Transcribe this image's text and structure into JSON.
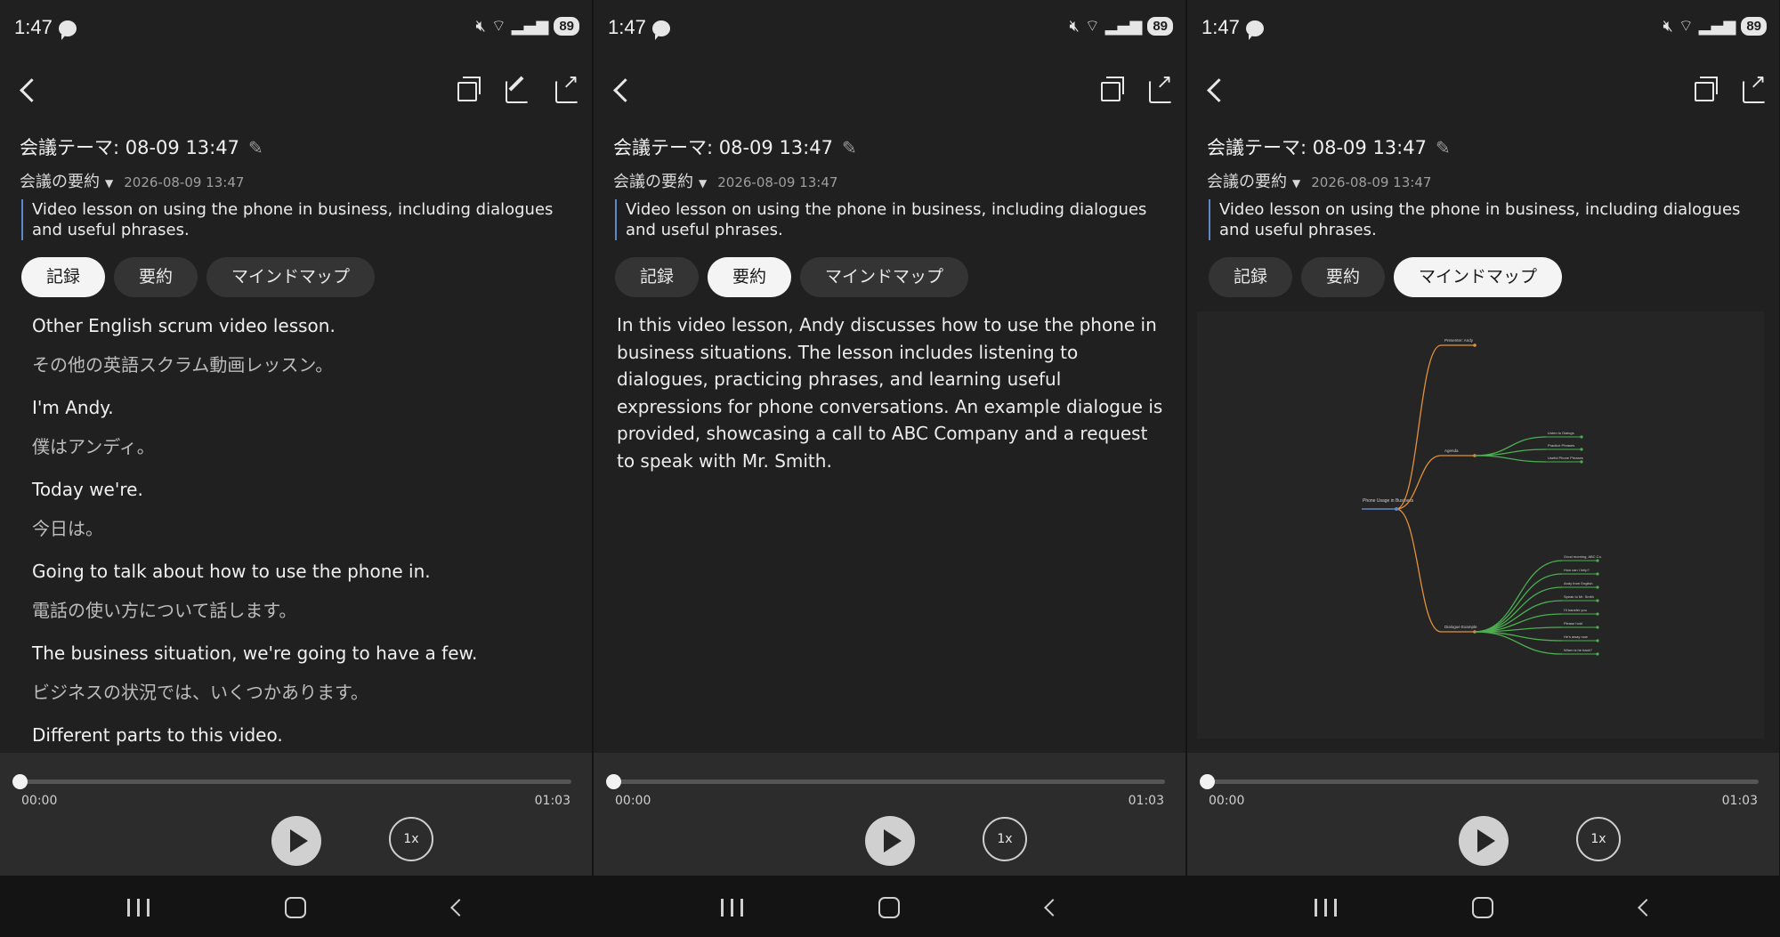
{
  "status_bar": {
    "time": "1:47",
    "battery": "89"
  },
  "meeting": {
    "title": "会議テーマ: 08-09 13:47",
    "summary_label": "会議の要約",
    "date": "2026-08-09 13:47",
    "short_summary": "Video lesson on using the phone in business, including dialogues and useful phrases."
  },
  "tabs": {
    "record": "記録",
    "summary": "要約",
    "mindmap": "マインドマップ"
  },
  "transcript": [
    {
      "en": "Other English scrum video lesson.",
      "ja": "その他の英語スクラム動画レッスン。"
    },
    {
      "en": "I'm Andy.",
      "ja": "僕はアンディ。"
    },
    {
      "en": "Today we're.",
      "ja": "今日は。"
    },
    {
      "en": "Going to talk about how to use the phone in.",
      "ja": "電話の使い方について話します。"
    },
    {
      "en": "The business situation, we're going to have a few.",
      "ja": "ビジネスの状況では、いくつかあります。"
    },
    {
      "en": "Different parts to this video.",
      "ja": ""
    }
  ],
  "summary_text": "In this video lesson, Andy discusses how to use the phone in business situations. The lesson includes listening to dialogues, practicing phrases, and learning useful expressions for phone conversations. An example dialogue is provided, showcasing a call to ABC Company and a request to speak with Mr. Smith.",
  "mindmap": {
    "root": "Phone Usage in Business",
    "nodes": {
      "presenter": "Presenter: Andy",
      "agenda": "Agenda",
      "dialogue": "Dialogue Example"
    },
    "agenda_items": [
      "Listen to Dialogs",
      "Practice Phrases",
      "Useful Phone Phrases"
    ],
    "dialogue_items": [
      "Good morning, ABC Co.",
      "How can I help?",
      "Andy from English",
      "Speak to Mr. Smith",
      "I'll transfer you",
      "Please hold",
      "He's away now",
      "When is he back?"
    ],
    "colors": {
      "branch": "#e2913a",
      "leaf": "#4caf50",
      "root": "#5e87c7"
    }
  },
  "player": {
    "current": "00:00",
    "duration": "01:03",
    "speed": "1x",
    "progress": 0
  }
}
